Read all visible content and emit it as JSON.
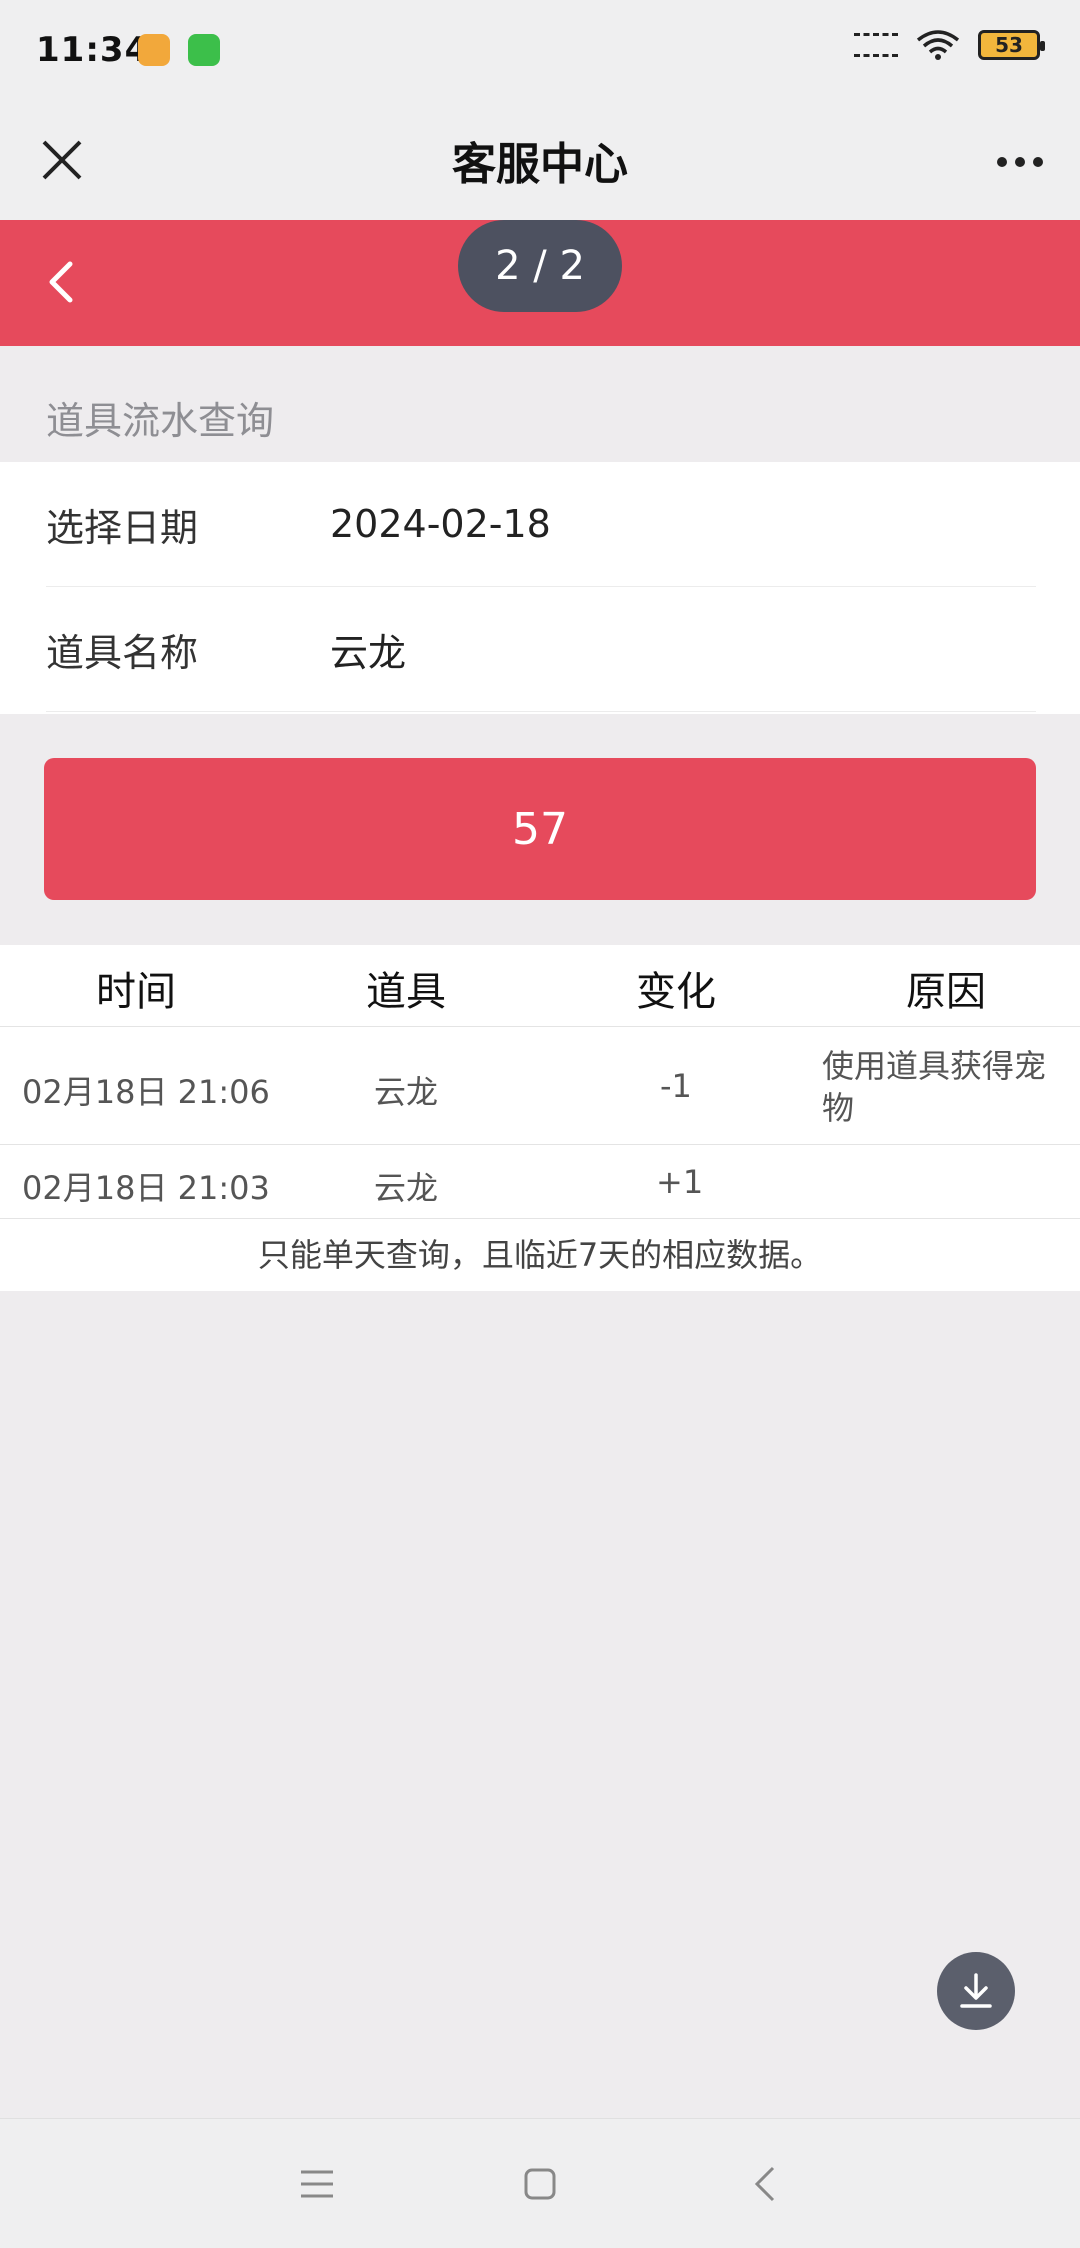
{
  "status_bar": {
    "time": "11:34",
    "battery": "53"
  },
  "header": {
    "title": "客服中心"
  },
  "banner": {
    "page_indicator": "2 / 2"
  },
  "section": {
    "title": "道具流水查询"
  },
  "form": {
    "date_label": "选择日期",
    "date_value": "2024-02-18",
    "item_label": "道具名称",
    "item_value": "云龙"
  },
  "query_button": {
    "label": "57"
  },
  "table": {
    "headers": [
      "时间",
      "道具",
      "变化",
      "原因"
    ],
    "rows": [
      {
        "time": "02月18日 21:06",
        "item": "云龙",
        "change": "-1",
        "reason": "使用道具获得宠物"
      },
      {
        "time": "02月18日 21:03",
        "item": "云龙",
        "change": "+1",
        "reason": ""
      }
    ],
    "note": "只能单天查询，且临近7天的相应数据。"
  },
  "colors": {
    "brand_red": "#e64a5c",
    "indicator_bg": "#4d5160",
    "background": "#eeecee"
  }
}
